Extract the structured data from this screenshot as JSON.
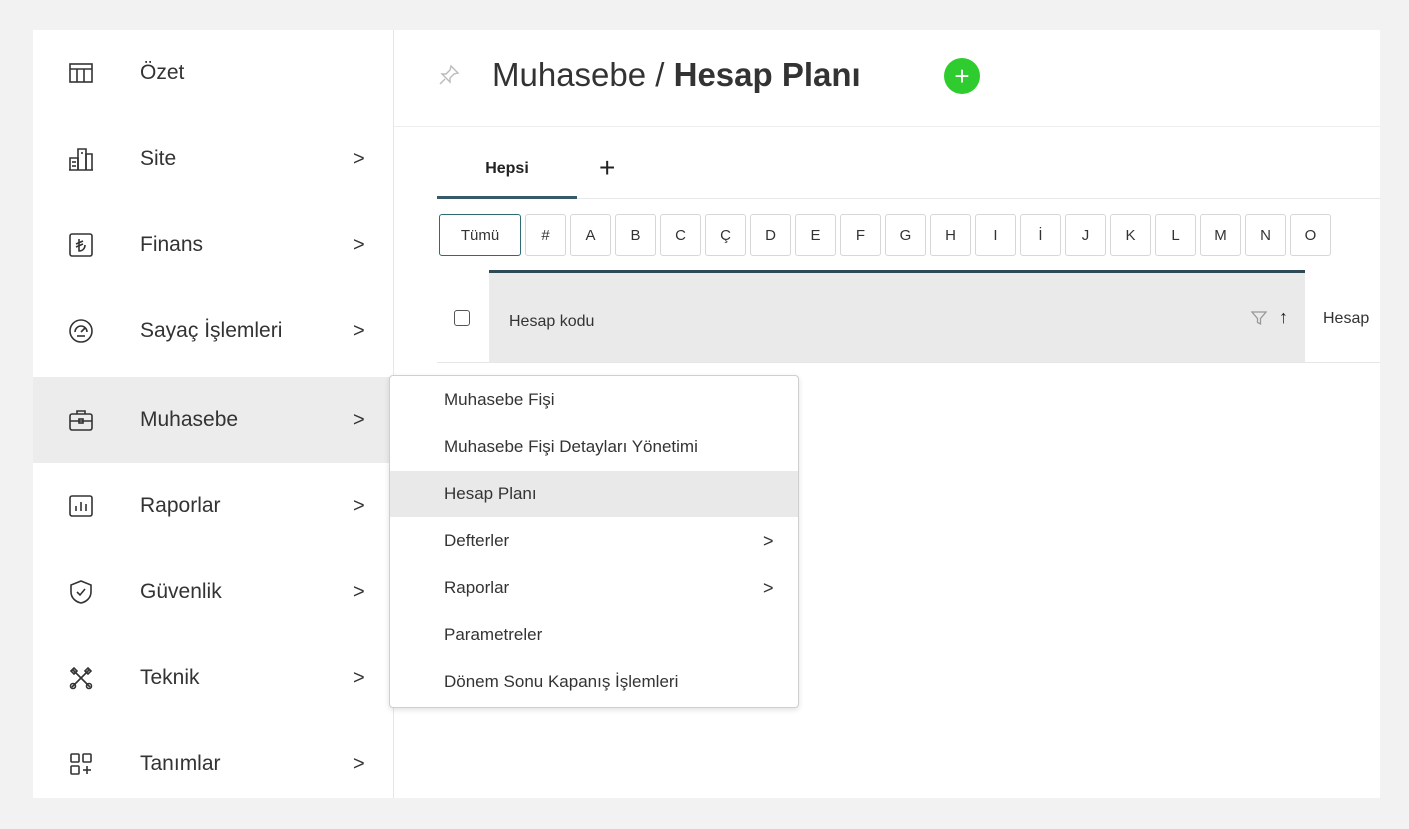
{
  "sidebar": {
    "items": [
      {
        "label": "Özet",
        "icon": "table-icon",
        "chevron": ""
      },
      {
        "label": "Site",
        "icon": "building-icon",
        "chevron": ">"
      },
      {
        "label": "Finans",
        "icon": "lira-icon",
        "chevron": ">"
      },
      {
        "label": "Sayaç İşlemleri",
        "icon": "gauge-icon",
        "chevron": ">"
      },
      {
        "label": "Muhasebe",
        "icon": "briefcase-icon",
        "chevron": ">"
      },
      {
        "label": "Raporlar",
        "icon": "bar-chart-icon",
        "chevron": ">"
      },
      {
        "label": "Güvenlik",
        "icon": "shield-icon",
        "chevron": ">"
      },
      {
        "label": "Teknik",
        "icon": "tools-icon",
        "chevron": ">"
      },
      {
        "label": "Tanımlar",
        "icon": "grid-plus-icon",
        "chevron": ">"
      }
    ]
  },
  "header": {
    "crumb": "Muhasebe / ",
    "current": "Hesap Planı",
    "add_symbol": "+"
  },
  "tabs": {
    "active": "Hepsi",
    "add_symbol": "+"
  },
  "letters": [
    "Tümü",
    "#",
    "A",
    "B",
    "C",
    "Ç",
    "D",
    "E",
    "F",
    "G",
    "H",
    "I",
    "İ",
    "J",
    "K",
    "L",
    "M",
    "N",
    "O"
  ],
  "grid": {
    "col1": "Hesap kodu",
    "sort_symbol": "↑",
    "col2": "Hesap"
  },
  "flyout": {
    "items": [
      {
        "label": "Muhasebe Fişi",
        "chevron": ""
      },
      {
        "label": "Muhasebe Fişi Detayları Yönetimi",
        "chevron": ""
      },
      {
        "label": "Hesap Planı",
        "chevron": ""
      },
      {
        "label": "Defterler",
        "chevron": ">"
      },
      {
        "label": "Raporlar",
        "chevron": ">"
      },
      {
        "label": "Parametreler",
        "chevron": ""
      },
      {
        "label": "Dönem Sonu Kapanış İşlemleri",
        "chevron": ""
      }
    ]
  },
  "colors": {
    "accent": "#2ecc2e",
    "active_tab": "#375a6b"
  }
}
